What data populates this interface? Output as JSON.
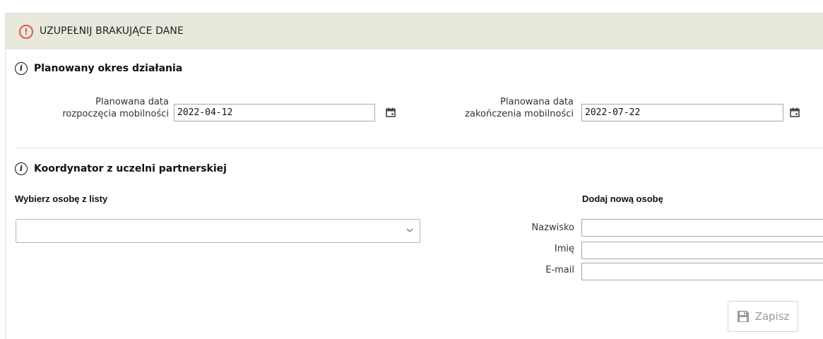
{
  "alert": {
    "icon": "exclamation-circle-icon",
    "text": "UZUPEŁNIJ BRAKUJĄCE DANE",
    "color": "#e05a4f",
    "background": "#e8e8dd"
  },
  "period": {
    "heading": "Planowany okres działania",
    "start": {
      "label_line1": "Planowana data",
      "label_line2": "rozpoczęcia mobilności",
      "value": "2022-04-12",
      "icon": "calendar-icon"
    },
    "end": {
      "label_line1": "Planowana data",
      "label_line2": "zakończenia mobilności",
      "value": "2022-07-22",
      "icon": "calendar-icon"
    }
  },
  "coordinator": {
    "heading": "Koordynator z uczelni partnerskiej",
    "select_label": "Wybierz osobę z listy",
    "select_value": "",
    "new_person_label": "Dodaj nową osobę",
    "fields": {
      "surname": {
        "label": "Nazwisko",
        "value": ""
      },
      "name": {
        "label": "Imię",
        "value": ""
      },
      "email": {
        "label": "E-mail",
        "value": ""
      }
    },
    "save": {
      "label": "Zapisz",
      "icon": "floppy-disk-icon",
      "disabled": true
    }
  }
}
